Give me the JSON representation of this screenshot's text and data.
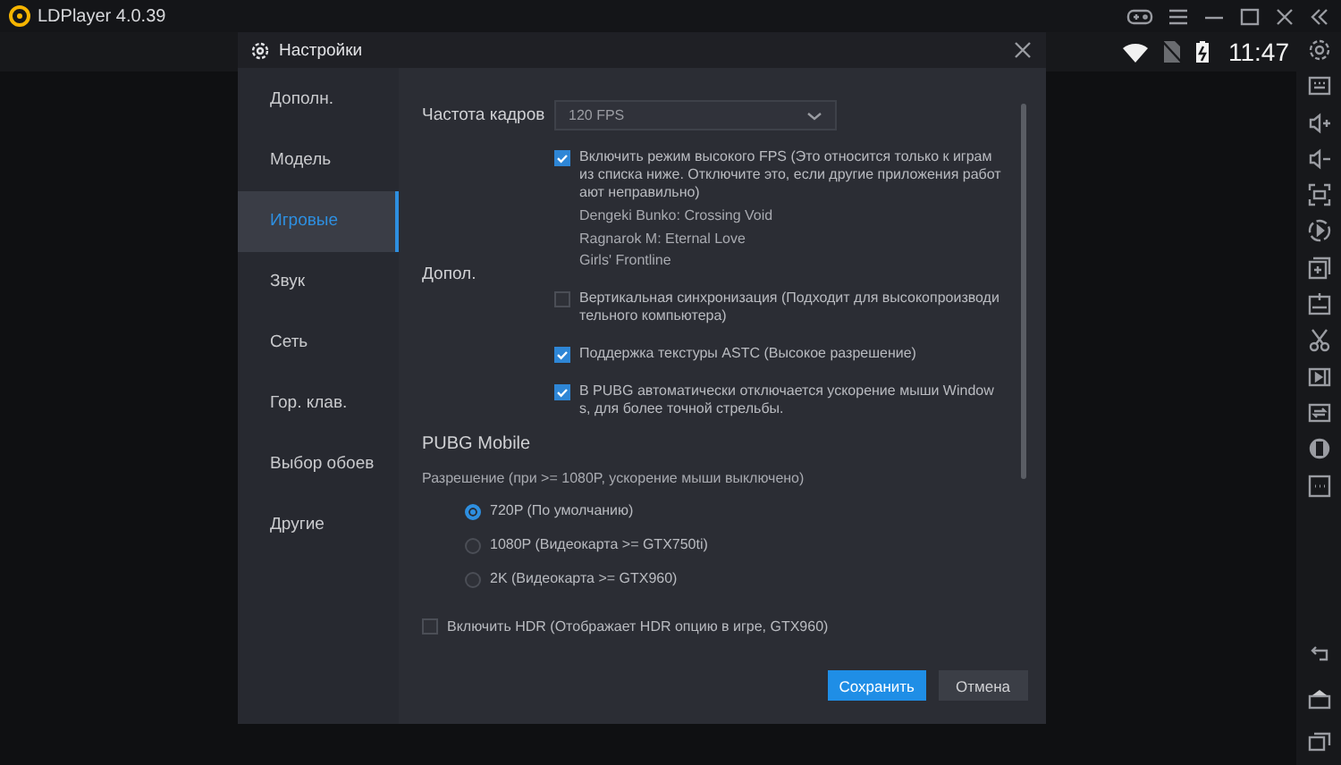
{
  "app": {
    "title": "LDPlayer 4.0.39"
  },
  "status_bar": {
    "time": "11:47"
  },
  "dialog": {
    "title": "Настройки"
  },
  "sidebar": [
    {
      "label": "Дополн.",
      "selected": false
    },
    {
      "label": "Модель",
      "selected": false
    },
    {
      "label": "Игровые",
      "selected": true
    },
    {
      "label": "Звук",
      "selected": false
    },
    {
      "label": "Сеть",
      "selected": false
    },
    {
      "label": "Гор. клав.",
      "selected": false
    },
    {
      "label": "Выбор обоев",
      "selected": false
    },
    {
      "label": "Другие",
      "selected": false
    }
  ],
  "frame_rate": {
    "label": "Частота кадров",
    "value": "120 FPS"
  },
  "extra": {
    "label": "Допол.",
    "options": [
      {
        "label": "Включить режим высокого FPS (Это относится только к играм из списка ниже. Отключите это, если другие приложения работают неправильно)",
        "checked": true,
        "games": [
          "Dengeki Bunko: Crossing Void",
          "Ragnarok M: Eternal Love",
          "Girls' Frontline"
        ]
      },
      {
        "label": "Вертикальная синхронизация (Подходит для высокопроизводительного компьютера)",
        "checked": false
      },
      {
        "label": "Поддержка текстуры ASTC (Высокое разрешение)",
        "checked": true
      },
      {
        "label": "В PUBG автоматически отключается ускорение мыши Windows, для более точной стрельбы.",
        "checked": true
      }
    ]
  },
  "pubg": {
    "title": "PUBG Mobile",
    "resolution_label": "Разрешение (при >= 1080P, ускорение мыши выключено)",
    "resolutions": [
      {
        "label": "720P (По умолчанию)",
        "selected": true
      },
      {
        "label": "1080P (Видеокарта >= GTX750ti)",
        "selected": false
      },
      {
        "label": "2K (Видеокарта >= GTX960)",
        "selected": false
      }
    ],
    "hdr": {
      "label": "Включить HDR (Отображает HDR опцию в игре, GTX960)",
      "checked": false
    }
  },
  "buttons": [
    {
      "label": "Сохранить",
      "kind": "primary"
    },
    {
      "label": "Отмена",
      "kind": "secondary"
    }
  ]
}
